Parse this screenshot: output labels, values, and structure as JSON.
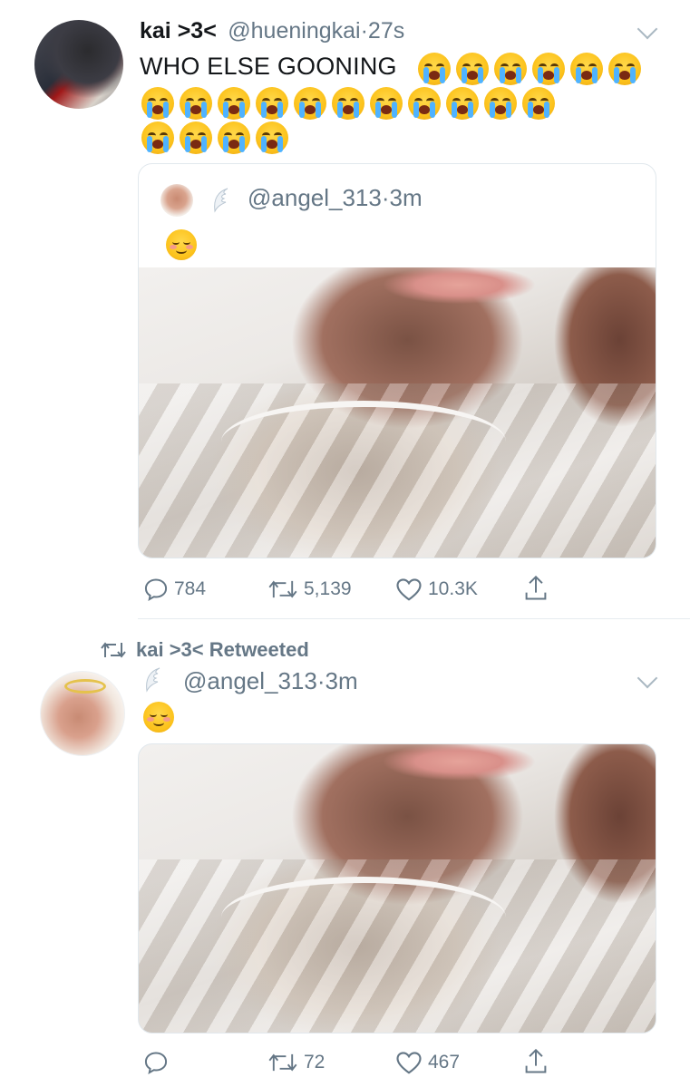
{
  "tweet1": {
    "display_name": "kai >3<",
    "handle": "@hueningkai",
    "time": "27s",
    "text": "WHO ELSE GOONING",
    "emoji": "loudly-crying-face",
    "emoji_count": 21,
    "quoted": {
      "handle": "@angel_313",
      "time": "3m",
      "emoji": "smiling-face"
    },
    "actions": {
      "reply_count": "784",
      "retweet_count": "5,139",
      "like_count": "10.3K"
    }
  },
  "tweet2": {
    "retweeted_by": "kai >3< Retweeted",
    "handle": "@angel_313",
    "time": "3m",
    "emoji": "smiling-face",
    "actions": {
      "reply_count": "",
      "retweet_count": "72",
      "like_count": "467"
    }
  },
  "separator": "·",
  "colors": {
    "muted": "#657786",
    "text": "#14171a",
    "border": "#e1e8ed",
    "icon": "#657786"
  },
  "icons": [
    "reply-icon",
    "retweet-icon",
    "like-icon",
    "share-icon",
    "chevron-down-icon",
    "angel-wings-icon"
  ]
}
